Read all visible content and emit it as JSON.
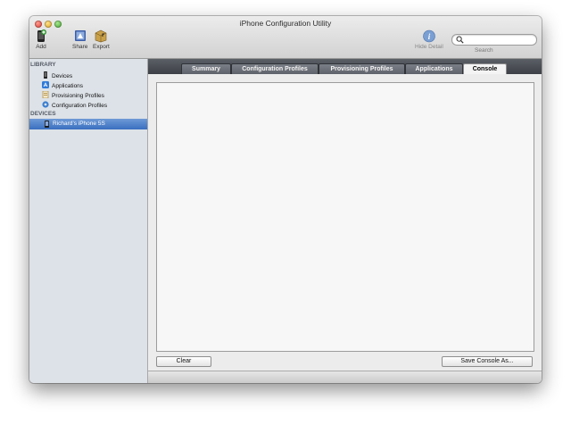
{
  "window": {
    "title": "iPhone Configuration Utility"
  },
  "toolbar": {
    "add_label": "Add",
    "share_label": "Share",
    "export_label": "Export",
    "hide_detail_label": "Hide Detail",
    "search_label": "Search",
    "search_placeholder": ""
  },
  "sidebar": {
    "library_header": "LIBRARY",
    "items": [
      {
        "label": "Devices",
        "icon": "iphone-icon"
      },
      {
        "label": "Applications",
        "icon": "app-store-icon"
      },
      {
        "label": "Provisioning Profiles",
        "icon": "certificate-icon"
      },
      {
        "label": "Configuration Profiles",
        "icon": "gear-icon"
      }
    ],
    "devices_header": "DEVICES",
    "device": {
      "label": "Richard’s iPhone 5S",
      "icon": "iphone-icon"
    }
  },
  "tabs": [
    {
      "label": "Summary",
      "active": false
    },
    {
      "label": "Configuration Profiles",
      "active": false
    },
    {
      "label": "Provisioning Profiles",
      "active": false
    },
    {
      "label": "Applications",
      "active": false
    },
    {
      "label": "Console",
      "active": true
    }
  ],
  "console": {
    "text": ""
  },
  "buttons": {
    "clear_label": "Clear",
    "save_label": "Save Console As..."
  },
  "colors": {
    "selection": "#3a6fc0",
    "tabstrip": "#4a4e55",
    "sidebar_bg": "#dde2e8"
  }
}
